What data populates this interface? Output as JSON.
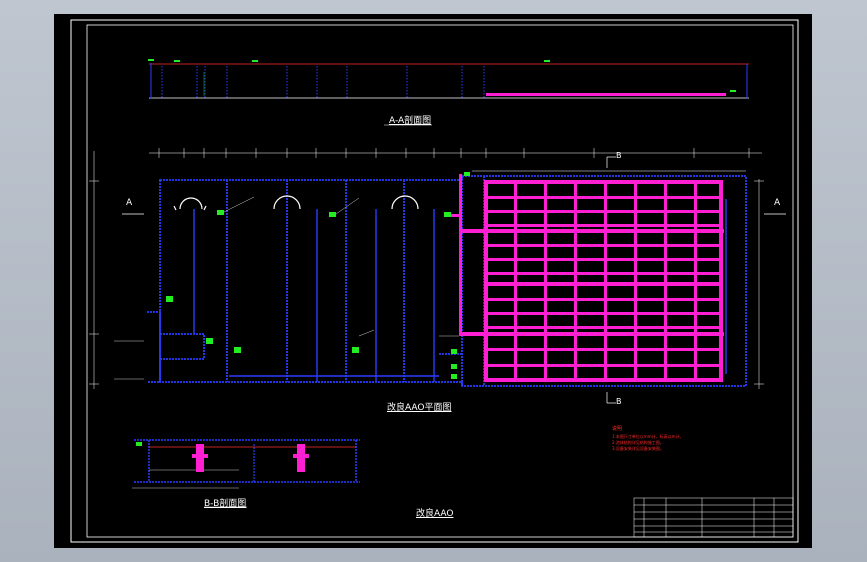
{
  "drawing": {
    "section_aa_title": "A-A剖面图",
    "plan_title": "改良AAO平面图",
    "section_bb_title": "B-B剖面图",
    "sheet_title": "改良AAO",
    "section_marks": {
      "a_left": "A",
      "a_right": "A",
      "b_top": "B",
      "b_bottom": "B"
    },
    "notes_heading": "说明",
    "notes": [
      "1.本图尺寸单位以mm计，标高以m计。",
      "2.池体结构详见结构施工图。",
      "3.设备安装详见设备安装图。"
    ]
  },
  "colors": {
    "sheet_bg": "#000000",
    "frame": "#ffffff",
    "walls": "#2a3cff",
    "pipes": "#ff1fd2",
    "annotation": "#22ee22",
    "notes": "#ff2a2a"
  },
  "icons": [
    "aerator-icon",
    "pipe-icon",
    "valve-icon"
  ]
}
